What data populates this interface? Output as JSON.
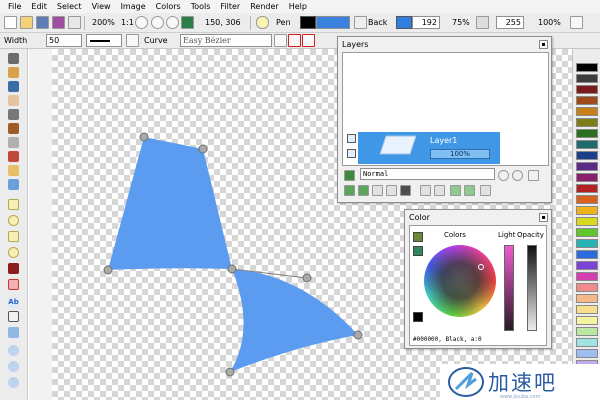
{
  "menu": {
    "items": [
      "File",
      "Edit",
      "Select",
      "View",
      "Image",
      "Colors",
      "Tools",
      "Filter",
      "Render",
      "Help"
    ]
  },
  "toolbar": {
    "zoom_percent": "200%",
    "zoom_ratio": "1:1",
    "cursor_coords": "150, 306",
    "pen_label": "Pen",
    "back_label": "Back",
    "back_value": "192",
    "back_percent": "75%",
    "alpha_value": "255",
    "alpha_percent": "100%"
  },
  "toolbar2": {
    "width_label": "Width",
    "width_value": "50",
    "curve_label": "Curve",
    "curve_value": "Easy Bézier"
  },
  "layers_panel": {
    "title": "Layers",
    "layer_name": "Layer1",
    "layer_opacity": "100%",
    "blend_mode": "Normal"
  },
  "color_panel": {
    "title": "Color",
    "colors_label": "Colors",
    "light_label": "Light",
    "opacity_label": "Opacity",
    "status": "#000000, Black, a:0"
  },
  "watermark": {
    "text": "加速吧",
    "sub": "www.jisuba.com"
  },
  "colors": {
    "shape_fill": "#5b9bf0",
    "layer_selected": "#3f97e6",
    "pen_color": "#000000",
    "back_color": "#2f7fe0"
  },
  "palette": [
    "#000000",
    "#3d3d3d",
    "#7a1b1b",
    "#a04a1c",
    "#c77f19",
    "#7d7d1a",
    "#2c6f1f",
    "#1f6a6a",
    "#1c3f8a",
    "#5a2a86",
    "#8a1f6b",
    "#b52121",
    "#d8611d",
    "#f0b21c",
    "#d9d91c",
    "#5fc72c",
    "#27b3b3",
    "#2a6be0",
    "#7a43d6",
    "#d63fb0",
    "#ef8b8b",
    "#f4b98a",
    "#f7de8c",
    "#f3f3a0",
    "#b9e8a0",
    "#9fe3e3",
    "#9dbdf3",
    "#c4a9ef",
    "#eea9de",
    "#ffffff"
  ]
}
